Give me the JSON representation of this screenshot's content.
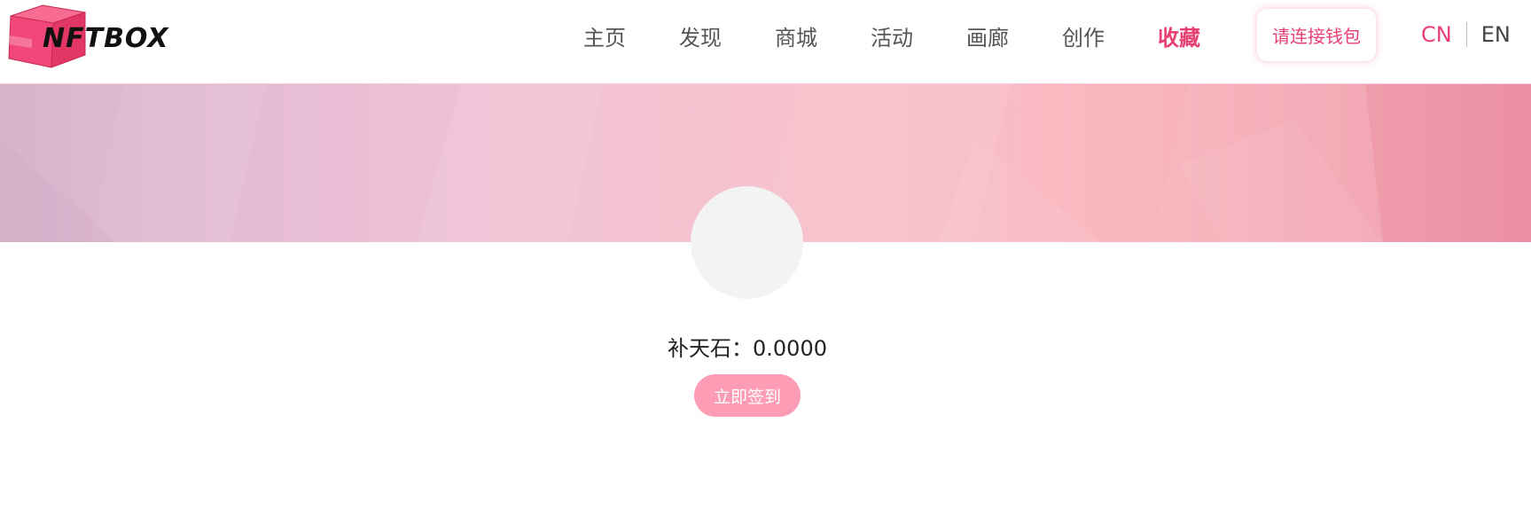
{
  "header": {
    "logo_text": "NFTBOX",
    "nav": [
      {
        "label": "主页"
      },
      {
        "label": "发现"
      },
      {
        "label": "商城"
      },
      {
        "label": "活动"
      },
      {
        "label": "画廊"
      },
      {
        "label": "创作"
      },
      {
        "label": "收藏",
        "active": true
      }
    ],
    "connect_wallet_label": "请连接钱包",
    "lang": {
      "cn": "CN",
      "en": "EN",
      "selected": "CN"
    }
  },
  "profile": {
    "balance_label": "补天石：",
    "balance_value": "0.0000",
    "signin_label": "立即签到"
  },
  "colors": {
    "accent": "#e83f72",
    "signin_button": "#fd9cb5",
    "avatar_placeholder": "#f3f3f3",
    "logo_box": "#f2477a"
  }
}
